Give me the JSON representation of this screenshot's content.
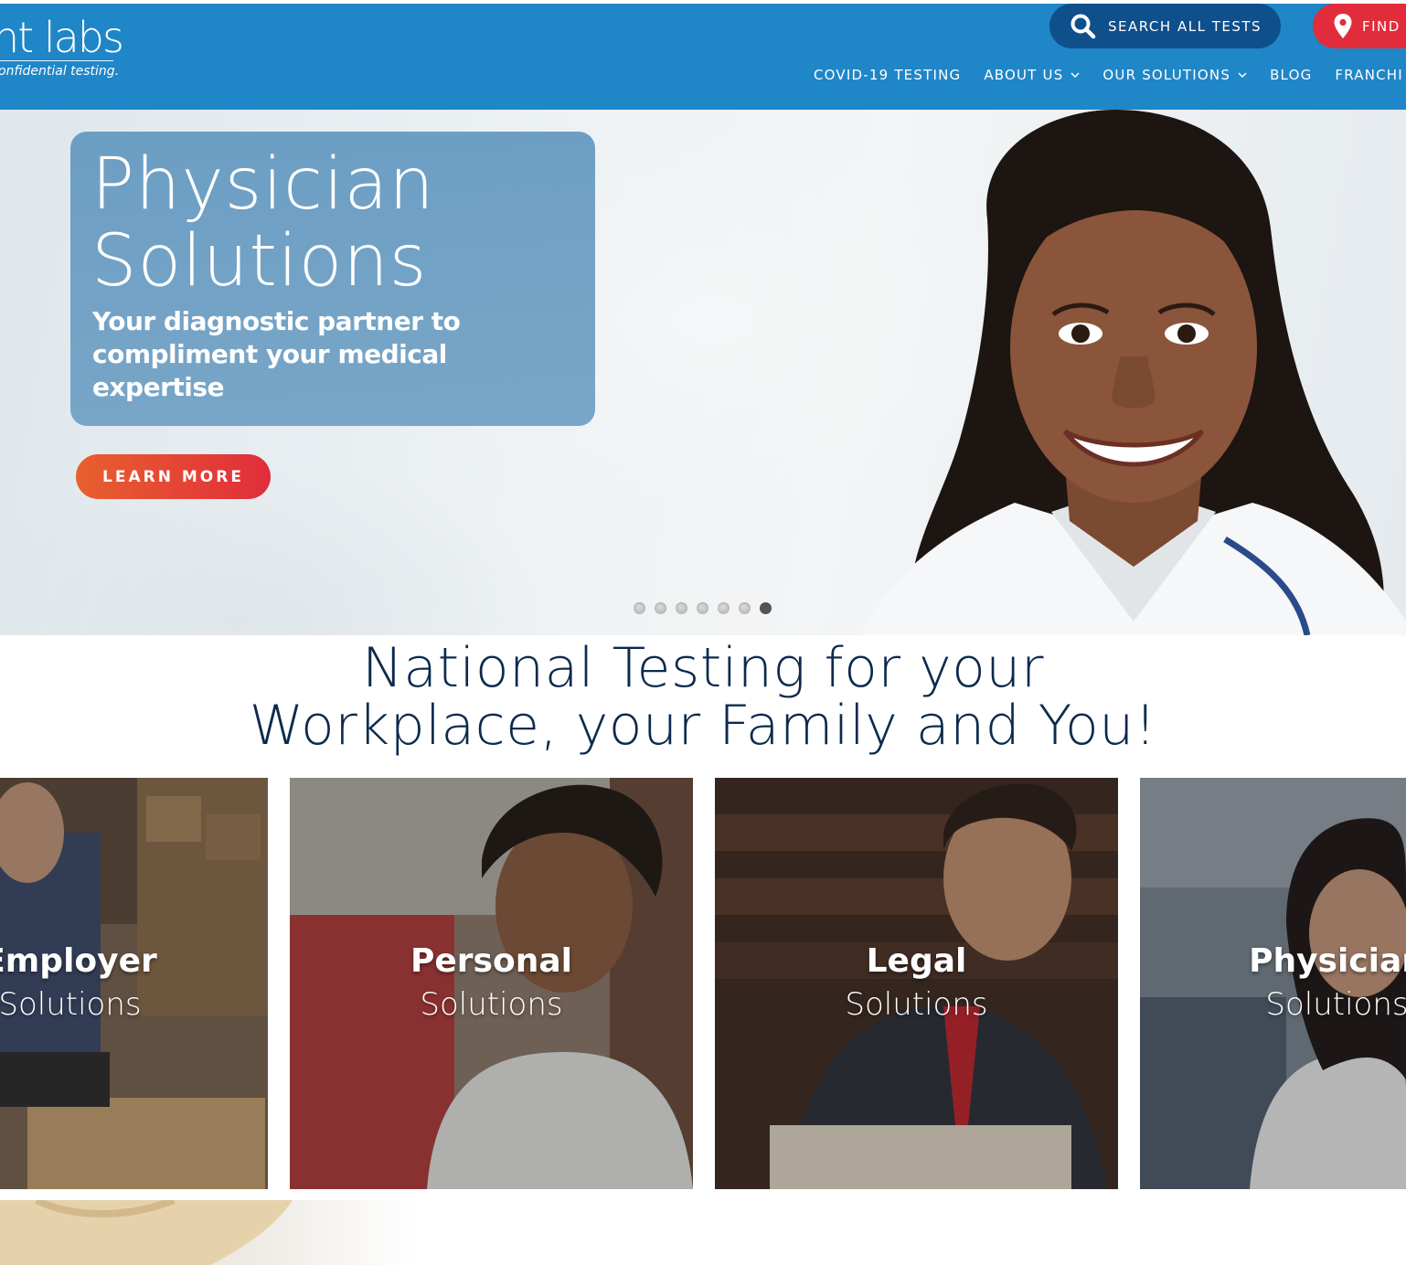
{
  "header": {
    "logo_text": "nt labs",
    "logo_tagline": "onfidential testing.",
    "search_label": "SEARCH ALL TESTS",
    "find_label": "FIND A",
    "nav": [
      {
        "label": "COVID-19 TESTING",
        "dropdown": false
      },
      {
        "label": "ABOUT US",
        "dropdown": true
      },
      {
        "label": "OUR SOLUTIONS",
        "dropdown": true
      },
      {
        "label": "BLOG",
        "dropdown": false
      },
      {
        "label": "FRANCHI",
        "dropdown": false
      }
    ],
    "colors": {
      "bar": "#1f86c8",
      "search": "#0f4f8c",
      "find": "#e12d3b"
    }
  },
  "hero": {
    "title_line1": "Physician",
    "title_line2": "Solutions",
    "subtitle": "Your diagnostic partner to compliment your medical expertise",
    "cta_label": "LEARN MORE",
    "slide_count": 7,
    "active_slide": 7
  },
  "section": {
    "heading_line1": "National Testing for your",
    "heading_line2": "Workplace, your Family and You!"
  },
  "cards": [
    {
      "title": "Employer",
      "subtitle": "Solutions"
    },
    {
      "title": "Personal",
      "subtitle": "Solutions"
    },
    {
      "title": "Legal",
      "subtitle": "Solutions"
    },
    {
      "title": "Physician",
      "subtitle": "Solutions"
    }
  ]
}
